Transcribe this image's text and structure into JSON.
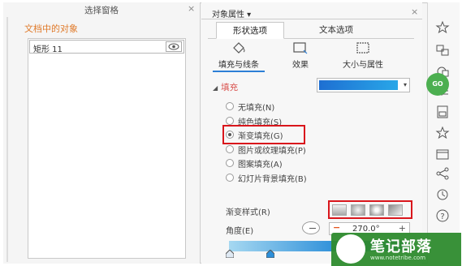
{
  "selection_pane": {
    "title": "选择窗格",
    "close_glyph": "×",
    "section_title": "文档中的对象",
    "objects": [
      {
        "name": "矩形 11",
        "visible_icon": "eye-icon"
      }
    ]
  },
  "properties_pane": {
    "header": "对象属性 ▾",
    "close_glyph": "×",
    "main_tabs": [
      {
        "label": "形状选项",
        "active": true
      },
      {
        "label": "文本选项",
        "active": false
      }
    ],
    "sub_tabs": [
      {
        "label": "填充与线条",
        "icon": "paint-bucket-icon",
        "active": true
      },
      {
        "label": "效果",
        "icon": "effects-icon",
        "active": false
      },
      {
        "label": "大小与属性",
        "icon": "size-icon",
        "active": false
      }
    ],
    "fill_section": {
      "title": "填充",
      "fill_color_dropdown": "gradient-blue",
      "options": [
        {
          "label": "无填充(N)",
          "selected": false
        },
        {
          "label": "纯色填充(S)",
          "selected": false
        },
        {
          "label": "渐变填充(G)",
          "selected": true
        },
        {
          "label": "图片或纹理填充(P)",
          "selected": false
        },
        {
          "label": "图案填充(A)",
          "selected": false
        },
        {
          "label": "幻灯片背景填充(B)",
          "selected": false
        }
      ]
    },
    "gradient_style_label": "渐变样式(R)",
    "angle_label": "角度(E)",
    "angle_value": "270.0°",
    "minus_glyph": "−",
    "plus_glyph": "+"
  },
  "right_toolbar": {
    "icons": [
      "star-icon",
      "shapes-icon",
      "copy-icon",
      "properties-icon",
      "save-icon",
      "favorite-icon",
      "library-icon",
      "share-icon",
      "history-icon",
      "help-icon"
    ],
    "badge": "GO"
  },
  "watermark": {
    "title": "笔记部落",
    "url": "www.notetribe.com"
  },
  "colors": {
    "accent_orange": "#e07a2a",
    "section_red": "#d9534f",
    "highlight_red": "#d9161c",
    "gradient_start": "#1e6fd2",
    "gradient_end": "#29a7e8"
  }
}
